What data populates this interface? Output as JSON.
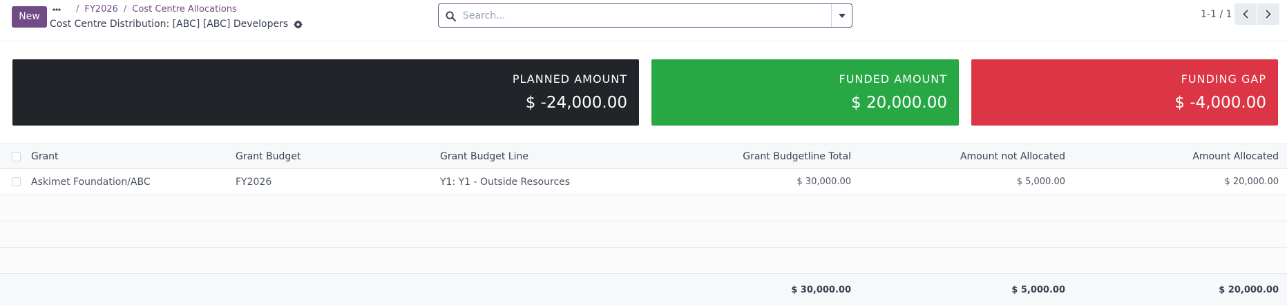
{
  "control_panel": {
    "new_button_label": "New",
    "breadcrumbs": [
      "FY2026",
      "Cost Centre Allocations"
    ],
    "record_title": "Cost Centre Distribution: [ABC] [ABC] Developers",
    "search_placeholder": "Search...",
    "pager_text": "1-1 / 1"
  },
  "kpis": {
    "planned": {
      "label": "PLANNED AMOUNT",
      "value": "$ -24,000.00",
      "color": "#212529"
    },
    "funded": {
      "label": "FUNDED AMOUNT",
      "value": "$ 20,000.00",
      "color": "#28a745"
    },
    "gap": {
      "label": "FUNDING GAP",
      "value": "$ -4,000.00",
      "color": "#dc3545"
    }
  },
  "table": {
    "columns": {
      "grant": "Grant",
      "grant_budget": "Grant Budget",
      "grant_budget_line": "Grant Budget Line",
      "budgetline_total": "Grant Budgetline Total",
      "amount_not_allocated": "Amount not Allocated",
      "amount_allocated": "Amount Allocated"
    },
    "rows": [
      {
        "grant": "Askimet Foundation/ABC",
        "grant_budget": "FY2026",
        "grant_budget_line": "Y1: Y1 - Outside Resources",
        "budgetline_total": "$ 30,000.00",
        "amount_not_allocated": "$ 5,000.00",
        "amount_allocated": "$ 20,000.00"
      }
    ],
    "totals": {
      "budgetline_total": "$ 30,000.00",
      "amount_not_allocated": "$ 5,000.00",
      "amount_allocated": "$ 20,000.00"
    }
  },
  "icons": {
    "breadcrumb_more": "ellipsis-icon",
    "record_settings": "gear-icon",
    "search": "search-icon",
    "search_toggle": "caret-down-icon",
    "pager_prev": "chevron-left-icon",
    "pager_next": "chevron-right-icon"
  },
  "theme": {
    "accent": "#714b86"
  }
}
